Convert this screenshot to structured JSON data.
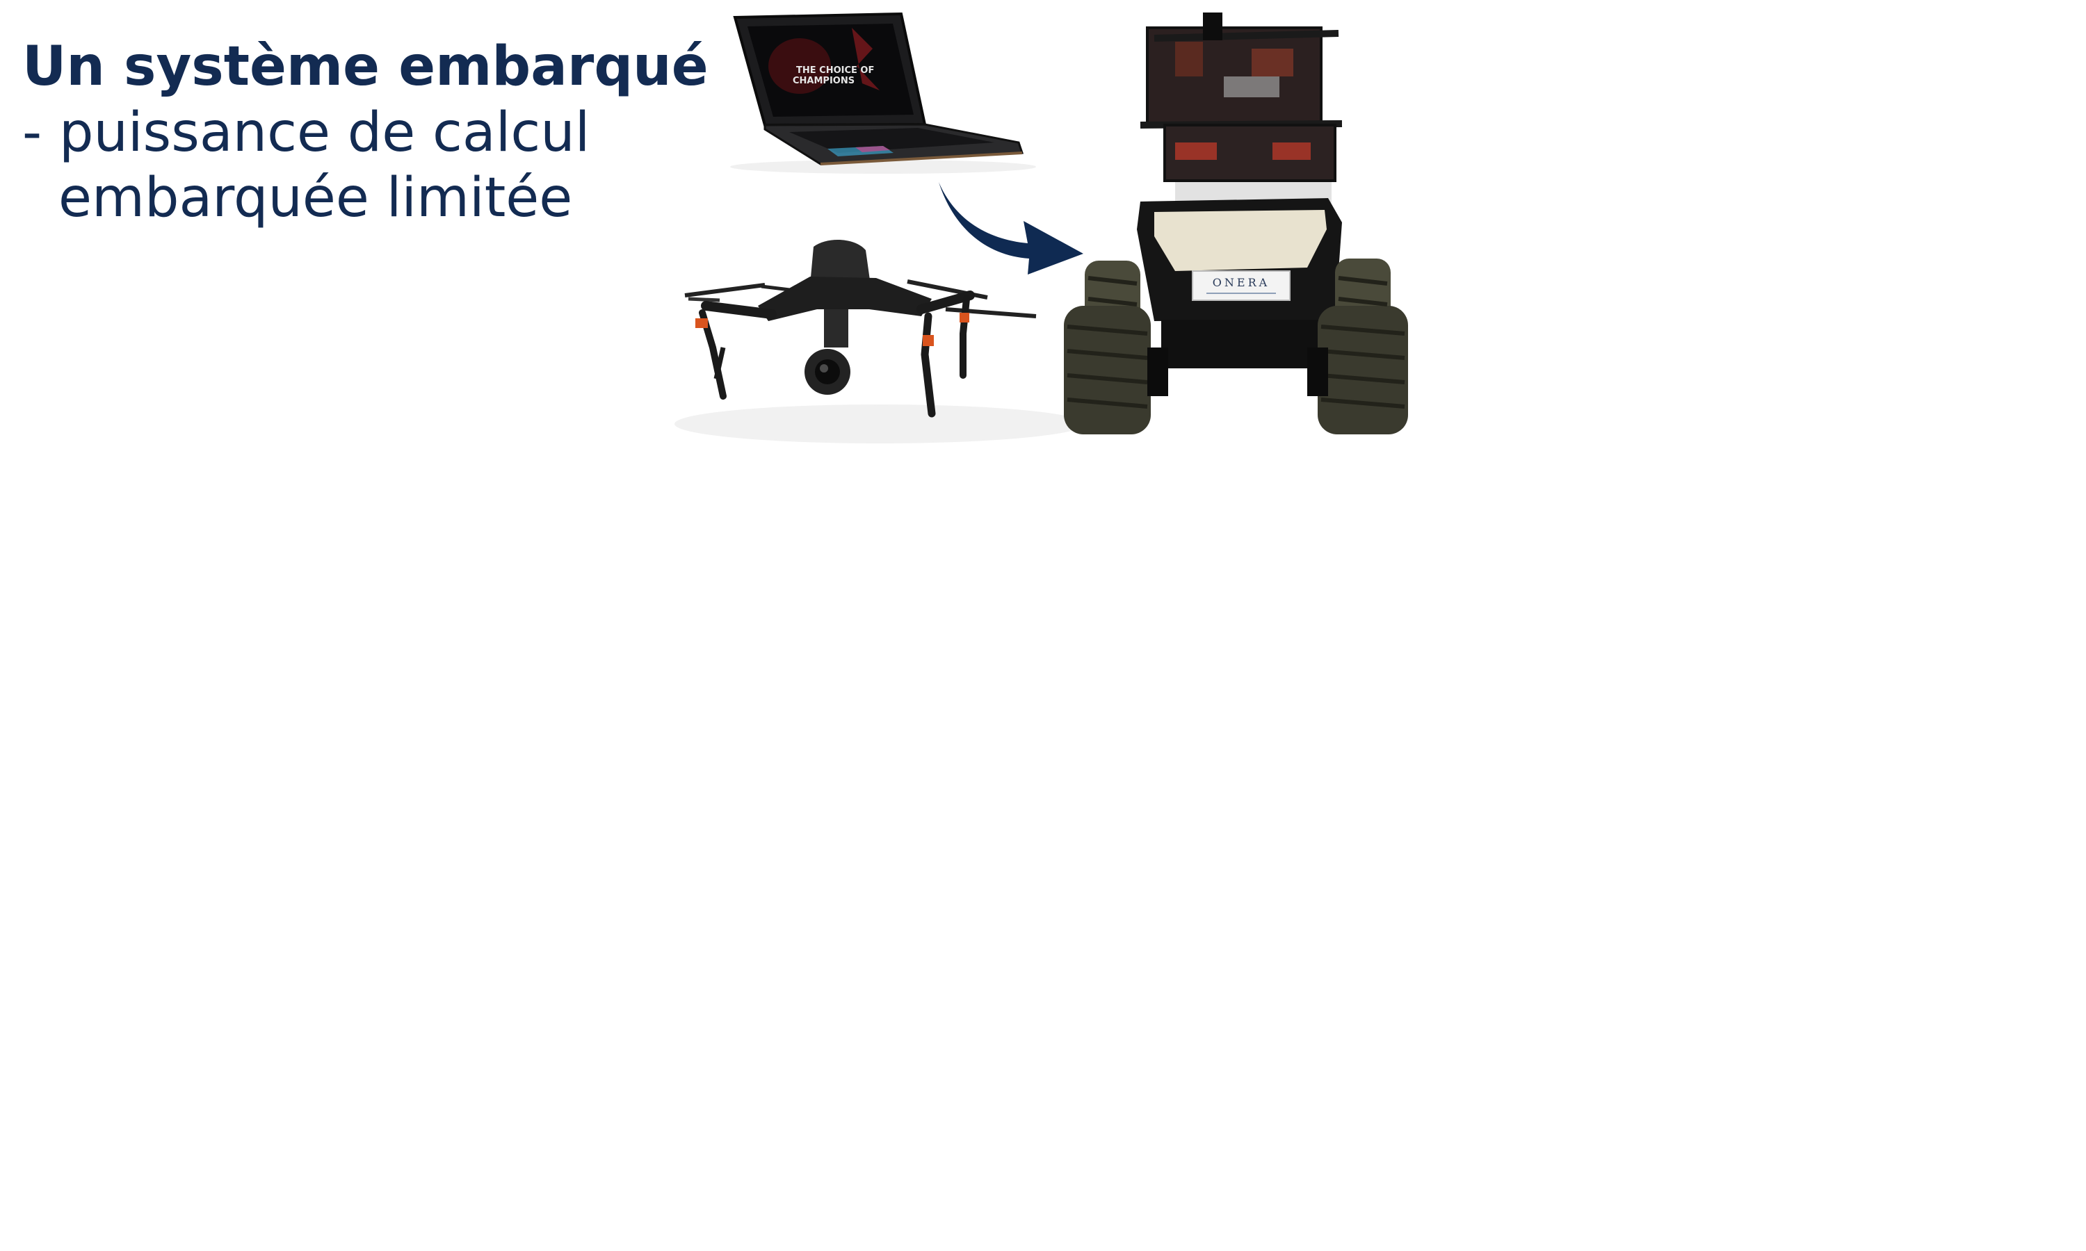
{
  "slide": {
    "title": "Un système embarqué",
    "bullet_line1": "- puissance de calcul",
    "bullet_line2": "embarquée limitée"
  },
  "laptop": {
    "screen_text_line1": "THE CHOICE OF",
    "screen_text_line2": "CHAMPIONS"
  },
  "robot": {
    "badge_label": "ONERA"
  },
  "colors": {
    "text": "#132b52",
    "arrow": "#0f2a52",
    "laptop_body": "#1c1c1e",
    "robot_body": "#151515",
    "robot_panel": "#e8e2cf",
    "tire": "#3a3a2e"
  },
  "icons": {
    "arrow": "curved-arrow-icon"
  }
}
